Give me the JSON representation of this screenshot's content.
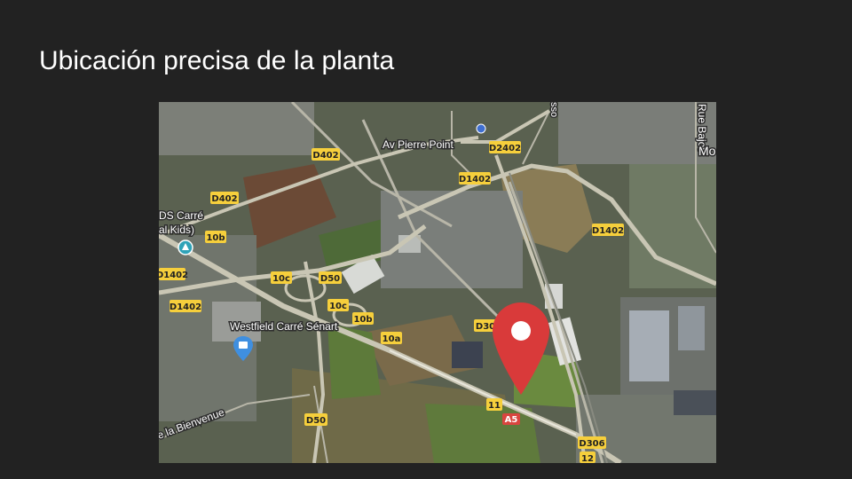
{
  "slide": {
    "title": "Ubicación precisa de la planta"
  },
  "map": {
    "place_labels": {
      "av_pierre_point": "Av Pierre Point",
      "westfield": "Westfield Carré Sénart",
      "carre_kids_1": "DS Carré",
      "carre_kids_2": "al Kids)",
      "la_bienvenue": "e la Bienvenue",
      "rue_bajot": "Rue Bajot",
      "mo": "Mo",
      "sso": "sso"
    },
    "road_labels": {
      "d402_a": "D402",
      "d402_b": "D402",
      "d2402": "D2402",
      "d1402_a": "D1402",
      "d1402_b": "D1402",
      "d1402_c": "D1402",
      "d1402_d": "D1402",
      "r10b_a": "10b",
      "r10b_b": "10b",
      "r10c_a": "10c",
      "r10c_b": "10c",
      "d50_a": "D50",
      "d50_b": "D50",
      "r10a": "10a",
      "d306_a": "D30",
      "d306_b": "D306",
      "r11": "11",
      "a5": "A5",
      "r12": "12"
    },
    "icons": {
      "location_pin": "map-pin-icon",
      "shopping": "shopping-bag-icon",
      "amusement": "amusement-icon",
      "transit": "transit-icon"
    },
    "colors": {
      "pin": "#d93a3a",
      "road_label_bg": "#f6cf3c",
      "motorway_label_bg": "#d9453f"
    }
  }
}
